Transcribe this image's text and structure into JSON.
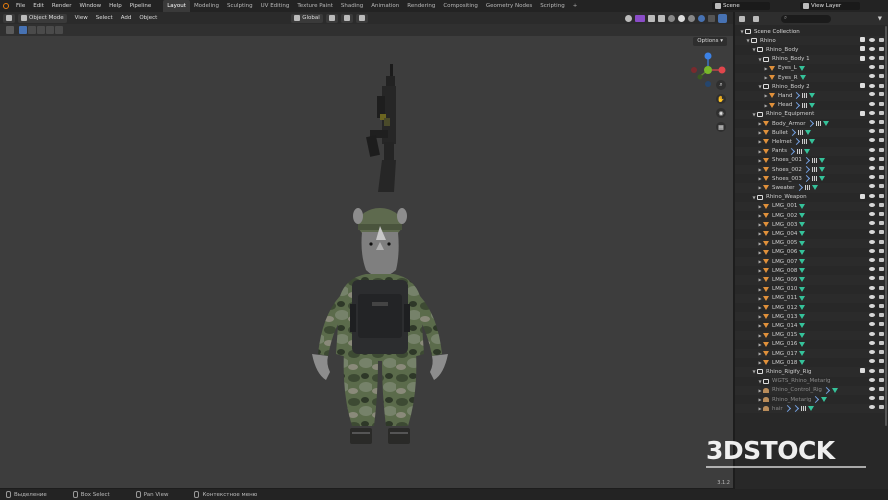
{
  "topbar": {
    "menus": [
      "File",
      "Edit",
      "Render",
      "Window",
      "Help",
      "Pipeline"
    ],
    "workspaces": [
      "Layout",
      "Modeling",
      "Sculpting",
      "UV Editing",
      "Texture Paint",
      "Shading",
      "Animation",
      "Rendering",
      "Compositing",
      "Geometry Nodes",
      "Scripting"
    ],
    "add_tab": "+",
    "scene": "Scene",
    "view_layer": "View Layer"
  },
  "viewport_header": {
    "mode": "Object Mode",
    "menus": [
      "View",
      "Select",
      "Add",
      "Object"
    ],
    "transform": "Global",
    "options": "Options"
  },
  "outliner": {
    "search_placeholder": "",
    "rows": [
      {
        "label": "Scene Collection",
        "type": "root",
        "depth": 0
      },
      {
        "label": "Rhino",
        "type": "col",
        "depth": 1,
        "chk": true
      },
      {
        "label": "Rhino_Body",
        "type": "col",
        "depth": 2,
        "chk": true
      },
      {
        "label": "Rhino_Body 1",
        "type": "col",
        "depth": 3,
        "chk": true
      },
      {
        "label": "Eyes_L",
        "type": "obj",
        "depth": 4,
        "mods": 0,
        "mats": 1
      },
      {
        "label": "Eyes_R",
        "type": "obj",
        "depth": 4,
        "mods": 0,
        "mats": 1
      },
      {
        "label": "Rhino_Body 2",
        "type": "col",
        "depth": 3,
        "chk": true
      },
      {
        "label": "Hand",
        "type": "obj",
        "depth": 4,
        "mods": 1,
        "mats": 1,
        "tex": true
      },
      {
        "label": "Head",
        "type": "obj",
        "depth": 4,
        "mods": 1,
        "mats": 1,
        "tex": true
      },
      {
        "label": "Rhino_Equipment",
        "type": "col",
        "depth": 2,
        "chk": true
      },
      {
        "label": "Body_Armor",
        "type": "obj",
        "depth": 3,
        "mods": 1,
        "mats": 1,
        "tex": true
      },
      {
        "label": "Bullet",
        "type": "obj",
        "depth": 3,
        "mods": 1,
        "mats": 1,
        "tex": true
      },
      {
        "label": "Helmet",
        "type": "obj",
        "depth": 3,
        "mods": 1,
        "mats": 1,
        "tex": true
      },
      {
        "label": "Pants",
        "type": "obj",
        "depth": 3,
        "mods": 1,
        "mats": 1,
        "tex": true
      },
      {
        "label": "Shoes_001",
        "type": "obj",
        "depth": 3,
        "mods": 1,
        "mats": 1,
        "tex": true
      },
      {
        "label": "Shoes_002",
        "type": "obj",
        "depth": 3,
        "mods": 1,
        "mats": 1,
        "tex": true
      },
      {
        "label": "Shoes_003",
        "type": "obj",
        "depth": 3,
        "mods": 1,
        "mats": 1,
        "tex": true
      },
      {
        "label": "Sweater",
        "type": "obj",
        "depth": 3,
        "mods": 1,
        "mats": 1,
        "tex": true
      },
      {
        "label": "Rhino_Weapon",
        "type": "col",
        "depth": 2,
        "chk": true
      },
      {
        "label": "LMG_001",
        "type": "obj",
        "depth": 3,
        "mods": 0,
        "mats": 1
      },
      {
        "label": "LMG_002",
        "type": "obj",
        "depth": 3,
        "mods": 0,
        "mats": 1
      },
      {
        "label": "LMG_003",
        "type": "obj",
        "depth": 3,
        "mods": 0,
        "mats": 1
      },
      {
        "label": "LMG_004",
        "type": "obj",
        "depth": 3,
        "mods": 0,
        "mats": 1
      },
      {
        "label": "LMG_005",
        "type": "obj",
        "depth": 3,
        "mods": 0,
        "mats": 1
      },
      {
        "label": "LMG_006",
        "type": "obj",
        "depth": 3,
        "mods": 0,
        "mats": 1
      },
      {
        "label": "LMG_007",
        "type": "obj",
        "depth": 3,
        "mods": 0,
        "mats": 1
      },
      {
        "label": "LMG_008",
        "type": "obj",
        "depth": 3,
        "mods": 0,
        "mats": 1
      },
      {
        "label": "LMG_009",
        "type": "obj",
        "depth": 3,
        "mods": 0,
        "mats": 1
      },
      {
        "label": "LMG_010",
        "type": "obj",
        "depth": 3,
        "mods": 0,
        "mats": 1
      },
      {
        "label": "LMG_011",
        "type": "obj",
        "depth": 3,
        "mods": 0,
        "mats": 1
      },
      {
        "label": "LMG_012",
        "type": "obj",
        "depth": 3,
        "mods": 0,
        "mats": 1
      },
      {
        "label": "LMG_013",
        "type": "obj",
        "depth": 3,
        "mods": 0,
        "mats": 1
      },
      {
        "label": "LMG_014",
        "type": "obj",
        "depth": 3,
        "mods": 0,
        "mats": 1
      },
      {
        "label": "LMG_015",
        "type": "obj",
        "depth": 3,
        "mods": 0,
        "mats": 1
      },
      {
        "label": "LMG_016",
        "type": "obj",
        "depth": 3,
        "mods": 0,
        "mats": 1
      },
      {
        "label": "LMG_017",
        "type": "obj",
        "depth": 3,
        "mods": 0,
        "mats": 1
      },
      {
        "label": "LMG_018",
        "type": "obj",
        "depth": 3,
        "mods": 0,
        "mats": 1
      },
      {
        "label": "Rhino_Rigify_Rig",
        "type": "col",
        "depth": 2,
        "chk": true
      },
      {
        "label": "WGTS_Rhino_Metarig",
        "type": "col",
        "depth": 3,
        "dim": true
      },
      {
        "label": "Rhino_Control_Rig",
        "type": "arm",
        "depth": 3,
        "dim": true,
        "mods": 1,
        "mats": 1
      },
      {
        "label": "Rhino_Metarig",
        "type": "arm",
        "depth": 3,
        "dim": true,
        "mods": 1,
        "mats": 1
      },
      {
        "label": "hair",
        "type": "arm",
        "depth": 3,
        "dim": true,
        "mods": 2,
        "mats": 1,
        "tex": true
      }
    ]
  },
  "statusbar": {
    "items": [
      "Выделение",
      "Box Select",
      "Pan View",
      "Контекстное меню"
    ]
  },
  "version": "3.1.2",
  "watermark": "3DSTOCK",
  "colors": {
    "accent": "#4772b3",
    "object": "#e0903a",
    "material": "#35c29a",
    "axis_x": "#e0464c",
    "axis_y": "#78b82a",
    "axis_z": "#3c82e6"
  }
}
